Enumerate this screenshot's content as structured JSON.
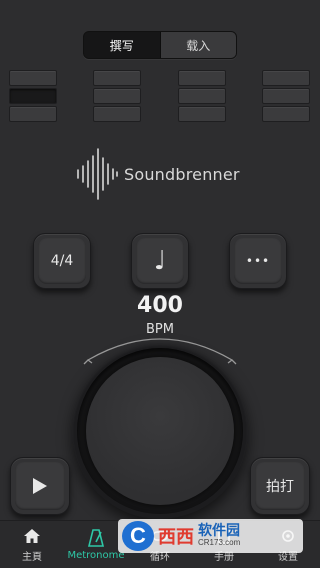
{
  "segment": {
    "write_label": "撰写",
    "load_label": "载入",
    "active": "write"
  },
  "beats": [
    {
      "cells": [
        false,
        true,
        false
      ]
    },
    {
      "cells": [
        false,
        false,
        false
      ]
    },
    {
      "cells": [
        false,
        false,
        false
      ]
    },
    {
      "cells": [
        false,
        false,
        false
      ]
    }
  ],
  "logo": {
    "text": "Soundbrenner"
  },
  "controls": {
    "time_signature": "4/4",
    "note_glyph": "♩",
    "more_glyph": "•••"
  },
  "tempo": {
    "value": "400",
    "unit": "BPM"
  },
  "tap_label": "拍打",
  "tabs": [
    {
      "label": "主頁",
      "icon": "home-icon"
    },
    {
      "label": "Metronome",
      "icon": "metronome-icon"
    },
    {
      "label": "循环",
      "icon": "loop-icon"
    },
    {
      "label": "手册",
      "icon": "manual-icon"
    },
    {
      "label": "设置",
      "icon": "settings-icon"
    }
  ],
  "watermark": {
    "letter": "C",
    "red": "西西",
    "title": "软件园",
    "url": "CR173.com"
  },
  "colors": {
    "accent": "#2ec7a6",
    "background": "#2d2d2f"
  }
}
